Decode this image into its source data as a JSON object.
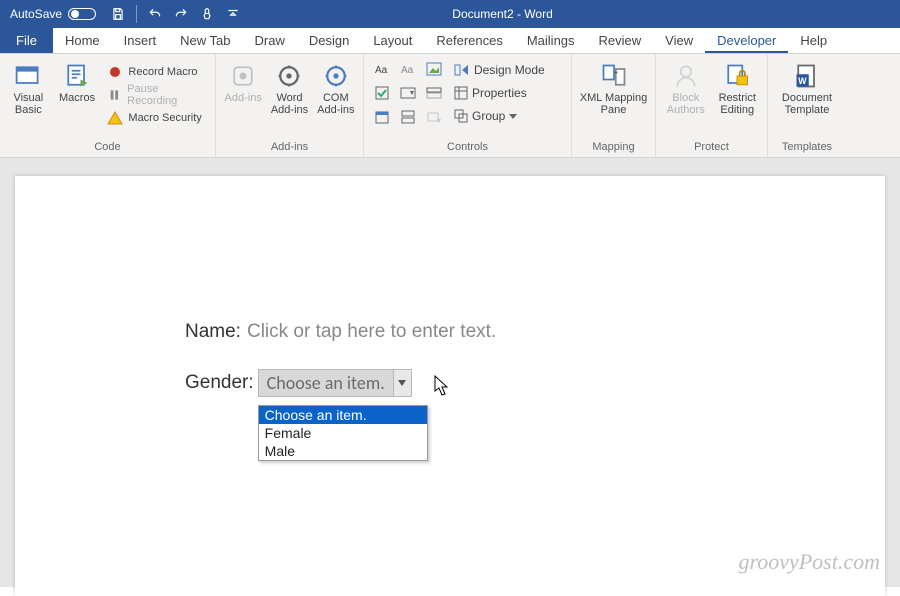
{
  "titlebar": {
    "autosave_label": "AutoSave",
    "autosave_state": "Off",
    "document_title": "Document2 - Word"
  },
  "tabs": {
    "file": "File",
    "items": [
      "Home",
      "Insert",
      "New Tab",
      "Draw",
      "Design",
      "Layout",
      "References",
      "Mailings",
      "Review",
      "View",
      "Developer",
      "Help"
    ],
    "active": "Developer"
  },
  "ribbon": {
    "code": {
      "label": "Code",
      "visual_basic": "Visual Basic",
      "macros": "Macros",
      "record_macro": "Record Macro",
      "pause_recording": "Pause Recording",
      "macro_security": "Macro Security"
    },
    "addins": {
      "label": "Add-ins",
      "addins": "Add-ins",
      "word_addins": "Word Add-ins",
      "com_addins": "COM Add-ins"
    },
    "controls": {
      "label": "Controls",
      "design_mode": "Design Mode",
      "properties": "Properties",
      "group": "Group"
    },
    "mapping": {
      "label": "Mapping",
      "xml_mapping": "XML Mapping Pane"
    },
    "protect": {
      "label": "Protect",
      "block_authors": "Block Authors",
      "restrict_editing": "Restrict Editing"
    },
    "templates": {
      "label": "Templates",
      "document_template": "Document Template"
    }
  },
  "document": {
    "name_label": "Name:",
    "name_placeholder": "Click or tap here to enter text.",
    "gender_label": "Gender:",
    "combo_selected": "Choose an item.",
    "options": [
      "Choose an item.",
      "Female",
      "Male"
    ]
  },
  "watermark": "groovyPost.com"
}
